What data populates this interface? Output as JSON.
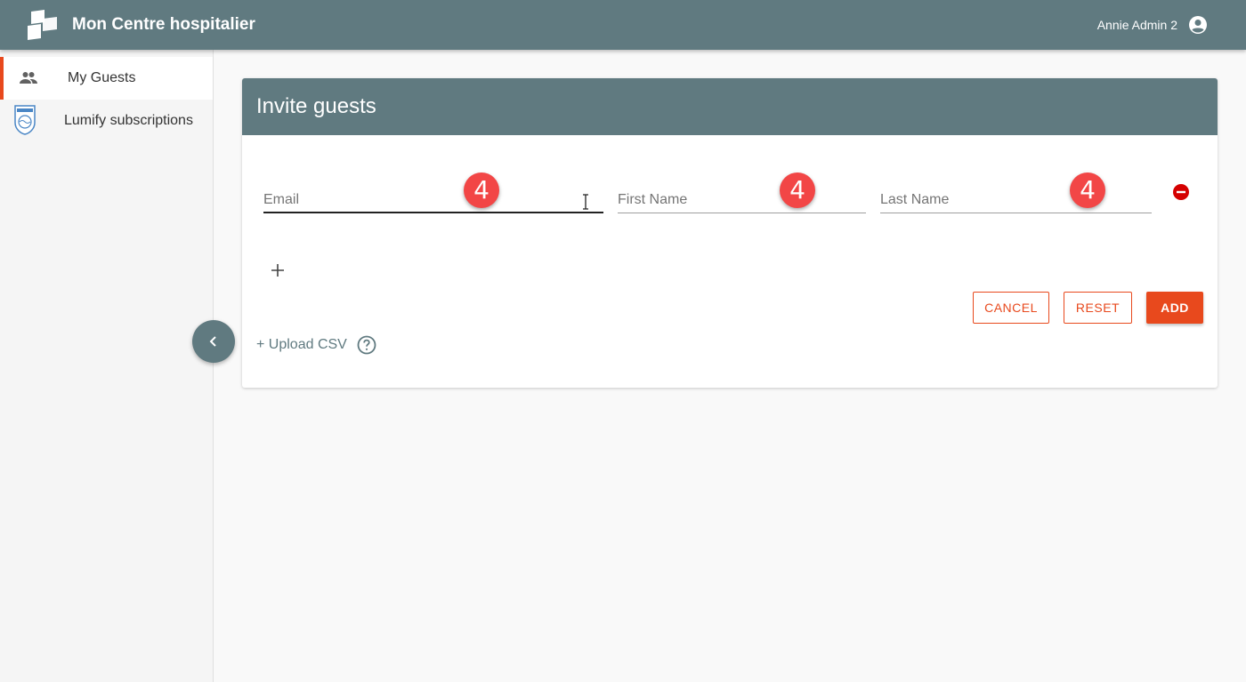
{
  "app": {
    "title": "Mon Centre hospitalier",
    "user_name": "Annie Admin 2"
  },
  "sidebar": {
    "items": [
      {
        "label": "My Guests",
        "icon": "people-icon",
        "active": true
      },
      {
        "label": "Lumify subscriptions",
        "icon": "philips-shield-icon",
        "active": false
      }
    ]
  },
  "card": {
    "title": "Invite guests",
    "fields": {
      "email_placeholder": "Email",
      "first_name_placeholder": "First Name",
      "last_name_placeholder": "Last Name"
    },
    "annotation_badges": [
      "4",
      "4",
      "4"
    ],
    "buttons": {
      "cancel": "CANCEL",
      "reset": "RESET",
      "add": "ADD"
    },
    "upload_csv": "+ Upload CSV"
  },
  "colors": {
    "header": "#607a80",
    "accent": "#e8491d",
    "badge": "#f24646",
    "remove": "#d50000"
  }
}
